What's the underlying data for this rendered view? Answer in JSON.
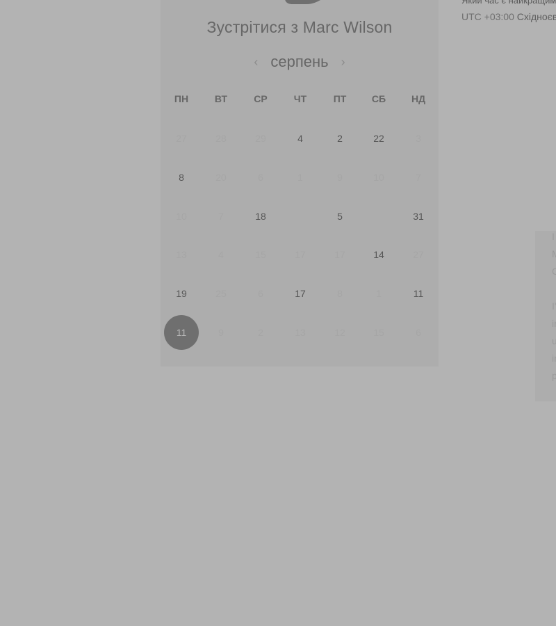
{
  "meeting": {
    "title": "Зустрітися з Marc Wilson"
  },
  "month": {
    "label": "серпень",
    "prev_icon": "chevron-left-icon",
    "next_icon": "chevron-right-icon"
  },
  "weekdays": [
    "ПН",
    "ВТ",
    "СР",
    "ЧТ",
    "ПТ",
    "СБ",
    "НД"
  ],
  "calendar": {
    "weeks": [
      [
        {
          "text": "27",
          "state": "unavailable"
        },
        {
          "text": "28",
          "state": "unavailable"
        },
        {
          "text": "29",
          "state": "unavailable"
        },
        {
          "text": "4",
          "state": "available"
        },
        {
          "text": "2",
          "state": "available"
        },
        {
          "text": "22",
          "state": "available"
        },
        {
          "text": "3",
          "state": "unavailable"
        }
      ],
      [
        {
          "text": "8",
          "state": "available"
        },
        {
          "text": "20",
          "state": "unavailable"
        },
        {
          "text": "6",
          "state": "unavailable"
        },
        {
          "text": "1",
          "state": "unavailable"
        },
        {
          "text": "9",
          "state": "unavailable"
        },
        {
          "text": "10",
          "state": "unavailable"
        },
        {
          "text": "7",
          "state": "unavailable"
        }
      ],
      [
        {
          "text": "10",
          "state": "unavailable"
        },
        {
          "text": "7",
          "state": "unavailable"
        },
        {
          "text": "18",
          "state": "available"
        },
        {
          "text": "",
          "state": "empty"
        },
        {
          "text": "5",
          "state": "available"
        },
        {
          "text": "",
          "state": "empty"
        },
        {
          "text": "31",
          "state": "available"
        }
      ],
      [
        {
          "text": "13",
          "state": "unavailable"
        },
        {
          "text": "4",
          "state": "unavailable"
        },
        {
          "text": "15",
          "state": "unavailable"
        },
        {
          "text": "17",
          "state": "unavailable"
        },
        {
          "text": "17",
          "state": "unavailable"
        },
        {
          "text": "14",
          "state": "available"
        },
        {
          "text": "27",
          "state": "unavailable"
        }
      ],
      [
        {
          "text": "19",
          "state": "available"
        },
        {
          "text": "25",
          "state": "unavailable"
        },
        {
          "text": "6",
          "state": "unavailable"
        },
        {
          "text": "17",
          "state": "available"
        },
        {
          "text": "8",
          "state": "unavailable"
        },
        {
          "text": "1",
          "state": "unavailable"
        },
        {
          "text": "11",
          "state": "available"
        }
      ],
      [
        {
          "text": "11",
          "state": "selected"
        },
        {
          "text": "9",
          "state": "unavailable"
        },
        {
          "text": "2",
          "state": "unavailable"
        },
        {
          "text": "13",
          "state": "unavailable"
        },
        {
          "text": "12",
          "state": "unavailable"
        },
        {
          "text": "15",
          "state": "unavailable"
        },
        {
          "text": "6",
          "state": "unavailable"
        }
      ]
    ]
  },
  "timezone": {
    "question": "Який час є найкращим?",
    "utc": "UTC +03:00",
    "name": "Східноєвропейський час"
  },
  "faded_text": [
    "І",
    "М",
    "С",
    "І'",
    "іr",
    "u",
    "іr",
    "р"
  ],
  "colors": {
    "page_overlay": "#b3b3b3",
    "calendar_background": "#adadad",
    "selected_day": "#6f6f6f"
  }
}
